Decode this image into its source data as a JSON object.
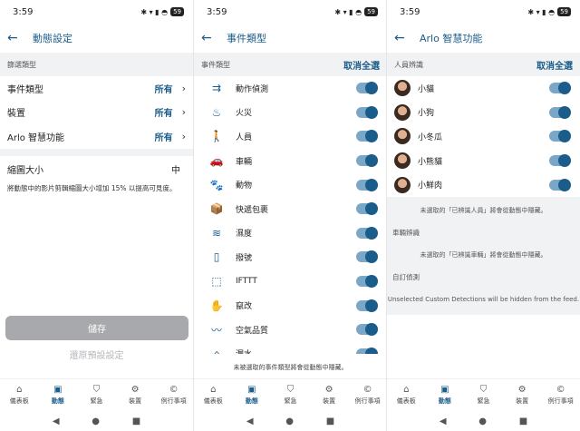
{
  "status_time": "3:59",
  "status_icons": "✱ ▾ ▮ ◓",
  "battery": "59",
  "nav": [
    {
      "label": "儀表板",
      "icon": "⌂"
    },
    {
      "label": "動態",
      "icon": "▣"
    },
    {
      "label": "緊急",
      "icon": "⛉"
    },
    {
      "label": "裝置",
      "icon": "⚙"
    },
    {
      "label": "例行事項",
      "icon": "©"
    }
  ],
  "sys_nav": {
    "back": "◀",
    "home": "●",
    "recents": "■"
  },
  "panel1": {
    "title": "動態設定",
    "section": "篩選類型",
    "rows": [
      {
        "label": "事件類型",
        "value": "所有"
      },
      {
        "label": "裝置",
        "value": "所有"
      },
      {
        "label": "Arlo 智慧功能",
        "value": "所有"
      }
    ],
    "thumb_label": "縮圖大小",
    "thumb_value": "中",
    "thumb_desc": "將動態中的影片剪輯縮圖大小增加 15% 以提高可見度。",
    "save": "儲存",
    "restore": "還原預設設定"
  },
  "panel2": {
    "title": "事件類型",
    "section": "事件類型",
    "action": "取消全選",
    "items": [
      {
        "label": "動作偵測",
        "icon": "⇉"
      },
      {
        "label": "火災",
        "icon": "♨"
      },
      {
        "label": "人員",
        "icon": "🚶"
      },
      {
        "label": "車輛",
        "icon": "🚗"
      },
      {
        "label": "動物",
        "icon": "🐾"
      },
      {
        "label": "快遞包裹",
        "icon": "📦"
      },
      {
        "label": "濕度",
        "icon": "≋"
      },
      {
        "label": "撥號",
        "icon": "▯"
      },
      {
        "label": "IFTTT",
        "icon": "⬚"
      },
      {
        "label": "竄改",
        "icon": "✋"
      },
      {
        "label": "空氣品質",
        "icon": "〰"
      },
      {
        "label": "漏水",
        "icon": "⌂"
      }
    ],
    "footer": "未被選取的事件類型將會從動態中隱藏。"
  },
  "panel3": {
    "title": "Arlo 智慧功能",
    "section": "人員辨識",
    "action": "取消全選",
    "people": [
      "小貓",
      "小狗",
      "小冬瓜",
      "小熊貓",
      "小鮮肉"
    ],
    "people_note": "未選取的「已辨識人員」將會從動態中隱藏。",
    "vehicle_head": "車輛辨識",
    "vehicle_note": "未選取的「已辨識車輛」將會從動態中隱藏。",
    "custom_head": "自訂偵測",
    "custom_note": "Unselected Custom Detections will be hidden from the feed."
  }
}
